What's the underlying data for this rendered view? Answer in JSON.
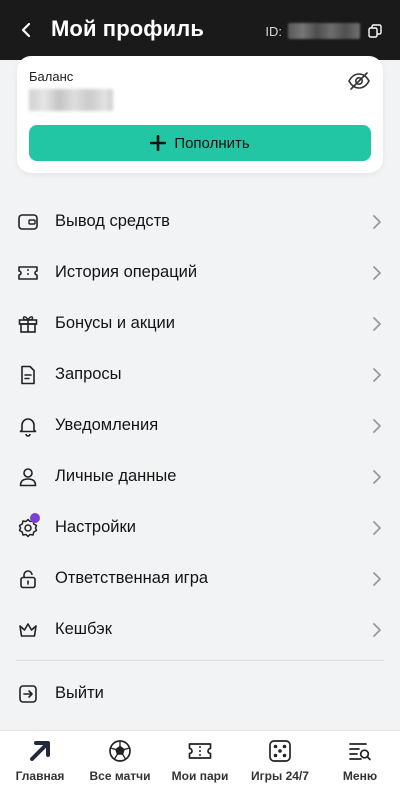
{
  "header": {
    "title": "Мой профиль",
    "id_label": "ID:"
  },
  "balance": {
    "label": "Баланс",
    "topup_label": "Пополнить"
  },
  "menu": {
    "items": [
      {
        "label": "Вывод средств",
        "icon": "wallet-icon"
      },
      {
        "label": "История операций",
        "icon": "ticket-icon"
      },
      {
        "label": "Бонусы и акции",
        "icon": "gift-icon"
      },
      {
        "label": "Запросы",
        "icon": "document-icon"
      },
      {
        "label": "Уведомления",
        "icon": "bell-icon"
      },
      {
        "label": "Личные данные",
        "icon": "user-icon"
      },
      {
        "label": "Настройки",
        "icon": "gear-icon"
      },
      {
        "label": "Ответственная игра",
        "icon": "lock-icon"
      },
      {
        "label": "Кешбэк",
        "icon": "crown-icon"
      }
    ],
    "logout_label": "Выйти"
  },
  "bottom_nav": {
    "items": [
      {
        "label": "Главная",
        "icon": "arrow-up-right-icon"
      },
      {
        "label": "Все матчи",
        "icon": "soccer-ball-icon"
      },
      {
        "label": "Мои пари",
        "icon": "ticket-icon"
      },
      {
        "label": "Игры 24/7",
        "icon": "dice-icon"
      },
      {
        "label": "Меню",
        "icon": "menu-search-icon"
      }
    ]
  },
  "colors": {
    "accent": "#23c6a4",
    "header_bg": "#1a1a1a",
    "badge": "#7a3fd6"
  }
}
